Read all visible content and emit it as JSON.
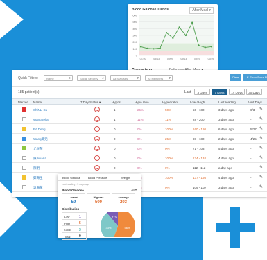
{
  "colors": {
    "background": "#1a8fd8",
    "accent": "#1a5f8f",
    "button": "#4a9ed6",
    "pink": "#d36a9a",
    "orange": "#e06a2a",
    "blue": "#2b7bbf"
  },
  "trend_chart": {
    "title": "Blood Glucose Trends",
    "dropdown": "After Meal ▾",
    "comparison_label": "Comparison",
    "comparison_values": "Before vs  After Meal ▾",
    "chart_data": {
      "type": "line",
      "x": [
        "07/20",
        "08/05",
        "08/13",
        "08/27",
        "09/08",
        "09/10",
        "09/13",
        "09/16",
        "09/20",
        "09/29",
        "09/30",
        "10/05"
      ],
      "values": [
        130,
        105,
        100,
        110,
        340,
        260,
        420,
        300,
        490,
        150,
        120,
        130
      ],
      "yticks": [
        "600",
        "500",
        "400",
        "300",
        "200",
        "100",
        "0"
      ],
      "xticks": [
        "07/20",
        "08/13",
        "09/09",
        "09/13",
        "09/20",
        "09/29"
      ],
      "ylim": [
        0,
        600
      ],
      "normal_band": [
        70,
        180
      ]
    }
  },
  "filters": {
    "label": "Quick Filters:",
    "name_placeholder": "Name",
    "ssn_placeholder": "Social Security",
    "status_placeholder": "All Statuses",
    "member_placeholder": "All Members",
    "clear": "Clear",
    "extra": "▼ Show Extra Filters"
  },
  "table": {
    "count": "185 patient(s)",
    "last_label": "Last",
    "ranges": [
      "3 Days",
      "7 Days",
      "14 Days",
      "30 Days"
    ],
    "active_range": 1,
    "headers": [
      "Marker",
      "Name",
      "7 Day Status ▾",
      "Hypos",
      "Hypo ratio",
      "Hyper ratio",
      "Low / High",
      "Last reading",
      "Visit Days"
    ],
    "rows": [
      {
        "marker": "#e03030",
        "name": "ShiNLi Su",
        "hypos": "1",
        "hypo_ratio": "25%",
        "hyper_ratio": "50%",
        "lowhigh": "50 - 180",
        "last": "3 days ago",
        "visit": "6/3"
      },
      {
        "marker": "",
        "name": "WangBella",
        "hypos": "1",
        "hypo_ratio": "11%",
        "hyper_ratio": "11%",
        "lowhigh": "28 - 200",
        "last": "3 days ago",
        "visit": "-"
      },
      {
        "marker": "#f2c230",
        "name": "Ed Deng",
        "hypos": "0",
        "hypo_ratio": "0%",
        "hyper_ratio": "100%",
        "lowhigh": "160 - 180",
        "last": "6 days ago",
        "visit": "5/27"
      },
      {
        "marker": "#3a8fe0",
        "name": "Wang莫无",
        "hypos": "0",
        "hypo_ratio": "0%",
        "hyper_ratio": "25%",
        "lowhigh": "98 - 180",
        "last": "2 days ago",
        "visit": "4/25"
      },
      {
        "marker": "#8dc63f",
        "name": "尤悦琴",
        "hypos": "0",
        "hypo_ratio": "0%",
        "hyper_ratio": "0%",
        "lowhigh": "71 - 103",
        "last": "5 days ago",
        "visit": "-"
      },
      {
        "marker": "",
        "name": "陳Juliana",
        "hypos": "0",
        "hypo_ratio": "0%",
        "hyper_ratio": "100%",
        "lowhigh": "124 - 134",
        "last": "4 days ago",
        "visit": "-"
      },
      {
        "marker": "",
        "name": "陳明",
        "hypos": "0",
        "hypo_ratio": "0%",
        "hyper_ratio": "0%",
        "lowhigh": "112 - 112",
        "last": "a day ago",
        "visit": "-"
      },
      {
        "marker": "#f2c230",
        "name": "鄭海生",
        "hypos": "0",
        "hypo_ratio": "0%",
        "hyper_ratio": "100%",
        "lowhigh": "137 - 166",
        "last": "4 days ago",
        "visit": "-"
      },
      {
        "marker": "",
        "name": "吳海蓮",
        "hypos": "0",
        "hypo_ratio": "0%",
        "hyper_ratio": "0%",
        "lowhigh": "109 - 110",
        "last": "3 days ago",
        "visit": "-"
      }
    ]
  },
  "popup": {
    "tabs": [
      "Blood Glucose",
      "Blood Pressure",
      "Weight"
    ],
    "last_reading": "Last reading - 5 days ago",
    "section": "Blood Glucose",
    "filter": "All ▾",
    "stats": [
      {
        "label": "Lowest",
        "value": "59",
        "color": "#2b7bbf"
      },
      {
        "label": "Highest",
        "value": "500",
        "color": "#e06a2a"
      },
      {
        "label": "Average",
        "value": "203",
        "color": "#e06a2a"
      }
    ],
    "distribution_title": "Distribution",
    "distribution": [
      {
        "label": "Low",
        "value": "1",
        "color": "#7a5cb5"
      },
      {
        "label": "High",
        "value": "5",
        "color": "#e06a2a"
      },
      {
        "label": "Good",
        "value": "3",
        "color": "#3ab0a8"
      },
      {
        "label": "Total",
        "value": "9",
        "color": "#333"
      }
    ],
    "chart_data": {
      "type": "pie",
      "labels": [
        "Low",
        "High",
        "Good"
      ],
      "values": [
        1,
        5,
        3
      ],
      "percent_labels": [
        "11%",
        "56%",
        "33%"
      ],
      "colors": [
        "#7a5cb5",
        "#f08a3c",
        "#7ec8c8"
      ]
    }
  }
}
